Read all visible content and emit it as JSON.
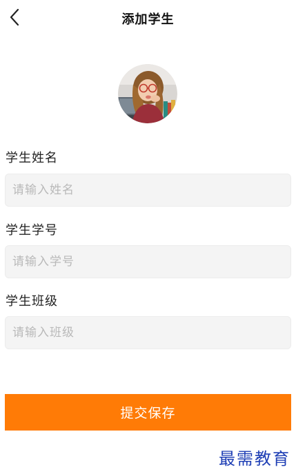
{
  "header": {
    "title": "添加学生",
    "back_icon": "chevron-left-icon"
  },
  "avatar": {
    "description_icon": "student-avatar-photo"
  },
  "form": {
    "name": {
      "label": "学生姓名",
      "placeholder": "请输入姓名",
      "value": ""
    },
    "number": {
      "label": "学生学号",
      "placeholder": "请输入学号",
      "value": ""
    },
    "class": {
      "label": "学生班级",
      "placeholder": "请输入班级",
      "value": ""
    }
  },
  "actions": {
    "submit_label": "提交保存"
  },
  "watermark": {
    "text": "最需教育"
  },
  "colors": {
    "accent": "#ff7b06",
    "input_bg": "#f4f4f4",
    "watermark": "#1f3fb5"
  }
}
